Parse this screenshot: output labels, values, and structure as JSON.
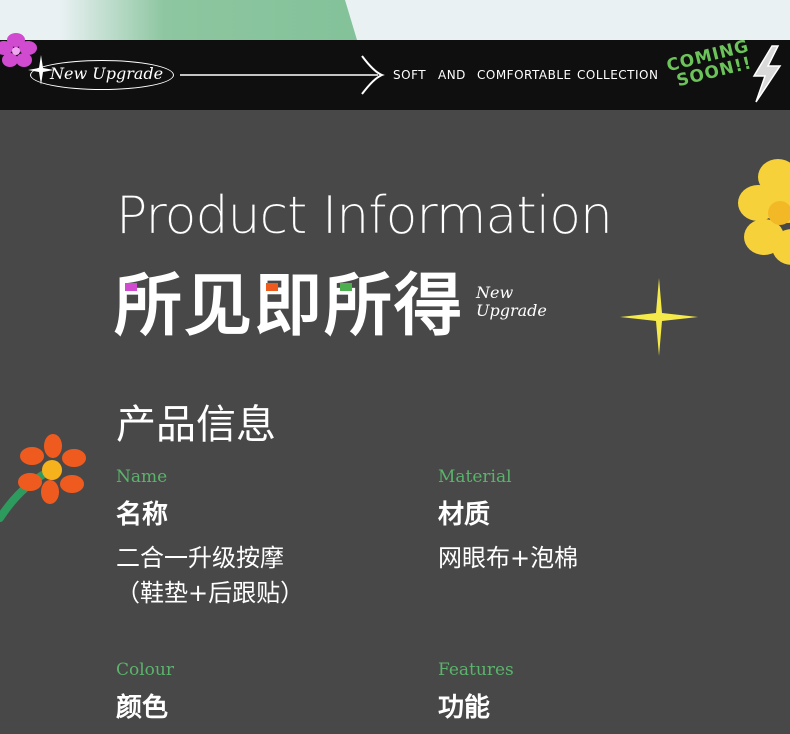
{
  "banner": {
    "badge": "New Upgrade",
    "tagline": [
      "SOFT",
      "AND",
      "COMFORTABLE",
      "COLLECTION"
    ],
    "coming_line1": "COMING",
    "coming_line2": "SOON!!"
  },
  "heading": {
    "english": "Product Information",
    "chinese": "所见即所得",
    "sub_line1": "New",
    "sub_line2": "Upgrade",
    "accent_colors": [
      "#d04bd0",
      "#ef5b1e",
      "#4caf50"
    ]
  },
  "section": {
    "title": "产品信息"
  },
  "fields": [
    {
      "label_en": "Name",
      "label_zh": "名称",
      "value_line1": "二合一升级按摩",
      "value_line2": "（鞋垫+后跟贴）"
    },
    {
      "label_en": "Material",
      "label_zh": "材质",
      "value_line1": "网眼布+泡棉",
      "value_line2": ""
    },
    {
      "label_en": "Colour",
      "label_zh": "颜色",
      "value_line1": "",
      "value_line2": ""
    },
    {
      "label_en": "Features",
      "label_zh": "功能",
      "value_line1": "",
      "value_line2": ""
    }
  ],
  "colors": {
    "background": "#484848",
    "banner": "#0f0f0f",
    "label_green": "#5bb36c",
    "coming_green": "#6bc35a",
    "flower_yellow": "#f7d13a",
    "flower_orange": "#ef5b1e",
    "flower_pink": "#d04bd0"
  }
}
